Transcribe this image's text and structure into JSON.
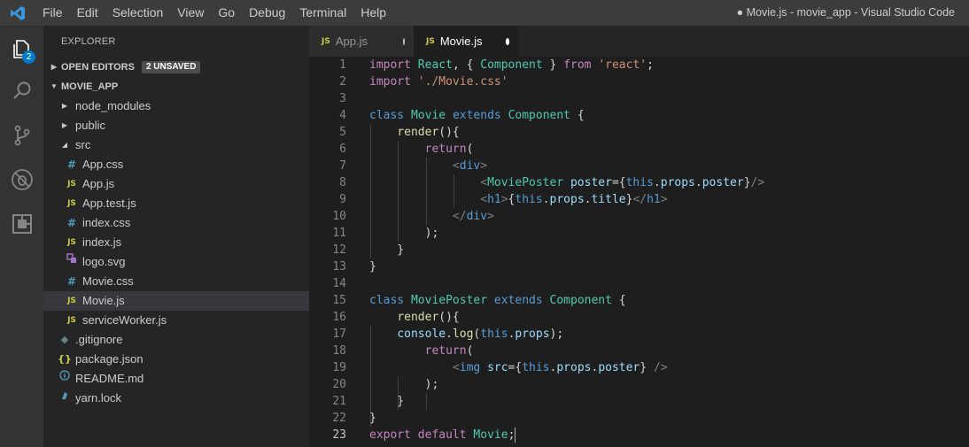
{
  "titlebar": {
    "menu": [
      "File",
      "Edit",
      "Selection",
      "View",
      "Go",
      "Debug",
      "Terminal",
      "Help"
    ],
    "window_title": "● Movie.js - movie_app - Visual Studio Code"
  },
  "activity": {
    "explorer_badge": "2"
  },
  "sidebar": {
    "title": "EXPLORER",
    "open_editors": "OPEN EDITORS",
    "unsaved": "2 UNSAVED",
    "project": "MOVIE_APP",
    "items": [
      {
        "label": "node_modules",
        "icon": "caret-right"
      },
      {
        "label": "public",
        "icon": "caret-right"
      },
      {
        "label": "src",
        "icon": "caret-down"
      },
      {
        "label": "App.css",
        "icon": "css"
      },
      {
        "label": "App.js",
        "icon": "js"
      },
      {
        "label": "App.test.js",
        "icon": "js"
      },
      {
        "label": "index.css",
        "icon": "css"
      },
      {
        "label": "index.js",
        "icon": "js"
      },
      {
        "label": "logo.svg",
        "icon": "svg"
      },
      {
        "label": "Movie.css",
        "icon": "css"
      },
      {
        "label": "Movie.js",
        "icon": "js"
      },
      {
        "label": "serviceWorker.js",
        "icon": "js"
      },
      {
        "label": ".gitignore",
        "icon": "git"
      },
      {
        "label": "package.json",
        "icon": "json"
      },
      {
        "label": "README.md",
        "icon": "info"
      },
      {
        "label": "yarn.lock",
        "icon": "yarn"
      }
    ]
  },
  "tabs": [
    {
      "label": "App.js",
      "active": false
    },
    {
      "label": "Movie.js",
      "active": true
    }
  ],
  "editor": {
    "js_icon_text": "JS",
    "current_line": 23,
    "lines": [
      {
        "n": "1",
        "t": "import React, { Component } from 'react';"
      },
      {
        "n": "2",
        "t": "import './Movie.css'"
      },
      {
        "n": "3",
        "t": ""
      },
      {
        "n": "4",
        "t": "class Movie extends Component {"
      },
      {
        "n": "5",
        "t": "    render(){"
      },
      {
        "n": "6",
        "t": "        return("
      },
      {
        "n": "7",
        "t": "            <div>"
      },
      {
        "n": "8",
        "t": "                <MoviePoster poster={this.props.poster}/>"
      },
      {
        "n": "9",
        "t": "                <h1>{this.props.title}</h1>"
      },
      {
        "n": "10",
        "t": "            </div>"
      },
      {
        "n": "11",
        "t": "        );"
      },
      {
        "n": "12",
        "t": "    }"
      },
      {
        "n": "13",
        "t": "}"
      },
      {
        "n": "14",
        "t": ""
      },
      {
        "n": "15",
        "t": "class MoviePoster extends Component {"
      },
      {
        "n": "16",
        "t": "    render(){"
      },
      {
        "n": "17",
        "t": "    console.log(this.props);"
      },
      {
        "n": "18",
        "t": "        return("
      },
      {
        "n": "19",
        "t": "            <img src={this.props.poster} />"
      },
      {
        "n": "20",
        "t": "        );"
      },
      {
        "n": "21",
        "t": "    }"
      },
      {
        "n": "22",
        "t": "}"
      },
      {
        "n": "23",
        "t": "export default Movie;"
      }
    ]
  },
  "colors": {
    "accent": "#007acc",
    "keyword": "#569cd6",
    "control": "#c586c0",
    "string": "#ce9178",
    "class": "#4ec9b0",
    "function": "#dcdcaa",
    "variable": "#9cdcfe"
  }
}
